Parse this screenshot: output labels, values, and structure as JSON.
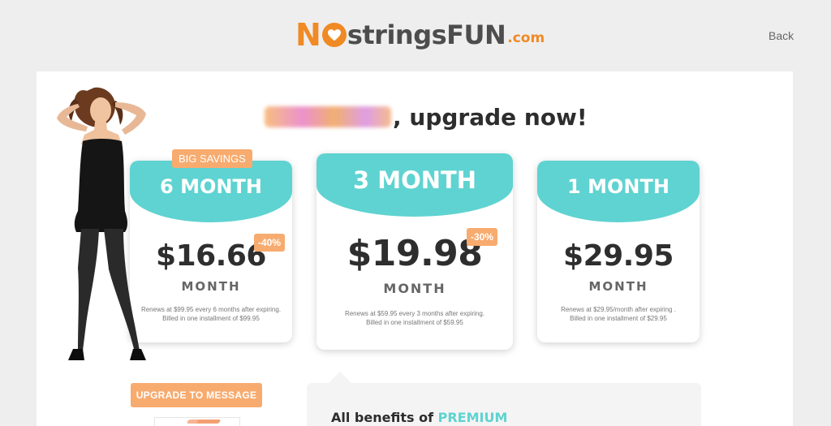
{
  "header": {
    "logo": {
      "n": "N",
      "strings": "strings",
      "fun": "FUN",
      "dotcom": ".com"
    },
    "back_label": "Back"
  },
  "headline": {
    "text": ", upgrade now!"
  },
  "plans": [
    {
      "title": "6 MONTH",
      "price": "$16.66",
      "unit": "MONTH",
      "discount": "-40%",
      "tag": "BIG SAVINGS",
      "note_line1": "Renews at $99.95 every 6 months after expiring.",
      "note_line2": "Billed in one installment of $99.95"
    },
    {
      "title": "3 MONTH",
      "price": "$19.98",
      "unit": "MONTH",
      "discount": "-30%",
      "note_line1": "Renews at $59.95 every 3 months after expiring.",
      "note_line2": "Billed in one installment of $59.95"
    },
    {
      "title": "1 MONTH",
      "price": "$29.95",
      "unit": "MONTH",
      "note_line1": "Renews at $29.95/month after expiring .",
      "note_line2": "Billed in one installment of $29.95"
    }
  ],
  "upgrade_message_label": "UPGRADE TO MESSAGE",
  "benefits": {
    "prefix": "All benefits of ",
    "highlight": "PREMIUM"
  },
  "colors": {
    "accent_teal": "#5fd3d1",
    "accent_orange": "#f7ab6f",
    "logo_orange": "#f08a24",
    "background": "#eeeeee"
  },
  "icons": {
    "logo_heart": "heart-icon"
  }
}
